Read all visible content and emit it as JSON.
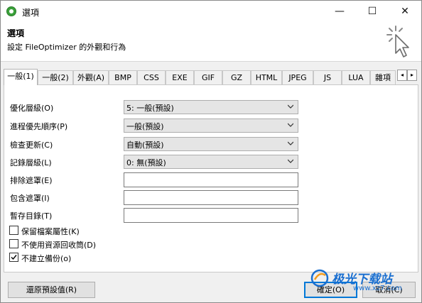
{
  "window": {
    "title": "選項",
    "minimize_glyph": "—",
    "maximize_glyph": "☐",
    "close_glyph": "✕"
  },
  "header": {
    "title": "選項",
    "subtitle": "設定 FileOptimizer 的外觀和行為"
  },
  "tabs": [
    {
      "label": "一般(1)",
      "active": true
    },
    {
      "label": "一般(2)"
    },
    {
      "label": "外觀(A)"
    },
    {
      "label": "BMP"
    },
    {
      "label": "CSS"
    },
    {
      "label": "EXE"
    },
    {
      "label": "GIF"
    },
    {
      "label": "GZ"
    },
    {
      "label": "HTML"
    },
    {
      "label": "JPEG"
    },
    {
      "label": "JS"
    },
    {
      "label": "LUA"
    },
    {
      "label": "雜項"
    }
  ],
  "tab_scroll": {
    "left": "◂",
    "right": "▸"
  },
  "settings": {
    "optimization_level": {
      "label": "優化層級(O)",
      "value": "5: 一般(預設)"
    },
    "process_priority": {
      "label": "進程優先順序(P)",
      "value": "一般(預設)"
    },
    "check_updates": {
      "label": "檢查更新(C)",
      "value": "自動(預設)"
    },
    "log_level": {
      "label": "記錄層級(L)",
      "value": "0: 無(預設)"
    },
    "exclude_mask": {
      "label": "排除遮罩(E)",
      "value": ""
    },
    "include_mask": {
      "label": "包含遮罩(I)",
      "value": ""
    },
    "temp_dir": {
      "label": "暫存目錄(T)",
      "value": ""
    }
  },
  "checkboxes": [
    {
      "label": "保留檔案屬性(K)",
      "checked": false
    },
    {
      "label": "不使用資源回收筒(D)",
      "checked": false
    },
    {
      "label": "不建立備份(o)",
      "checked": true
    }
  ],
  "buttons": {
    "restore_defaults": "還原預設值(R)",
    "ok": "確定(O)",
    "cancel": "取消(C)"
  },
  "watermark": {
    "text": "极光下载站",
    "url": "www.xz7.com"
  },
  "colors": {
    "accent": "#0078d7",
    "app_icon": "#3aa13a",
    "watermark": "#1a6fd0"
  }
}
